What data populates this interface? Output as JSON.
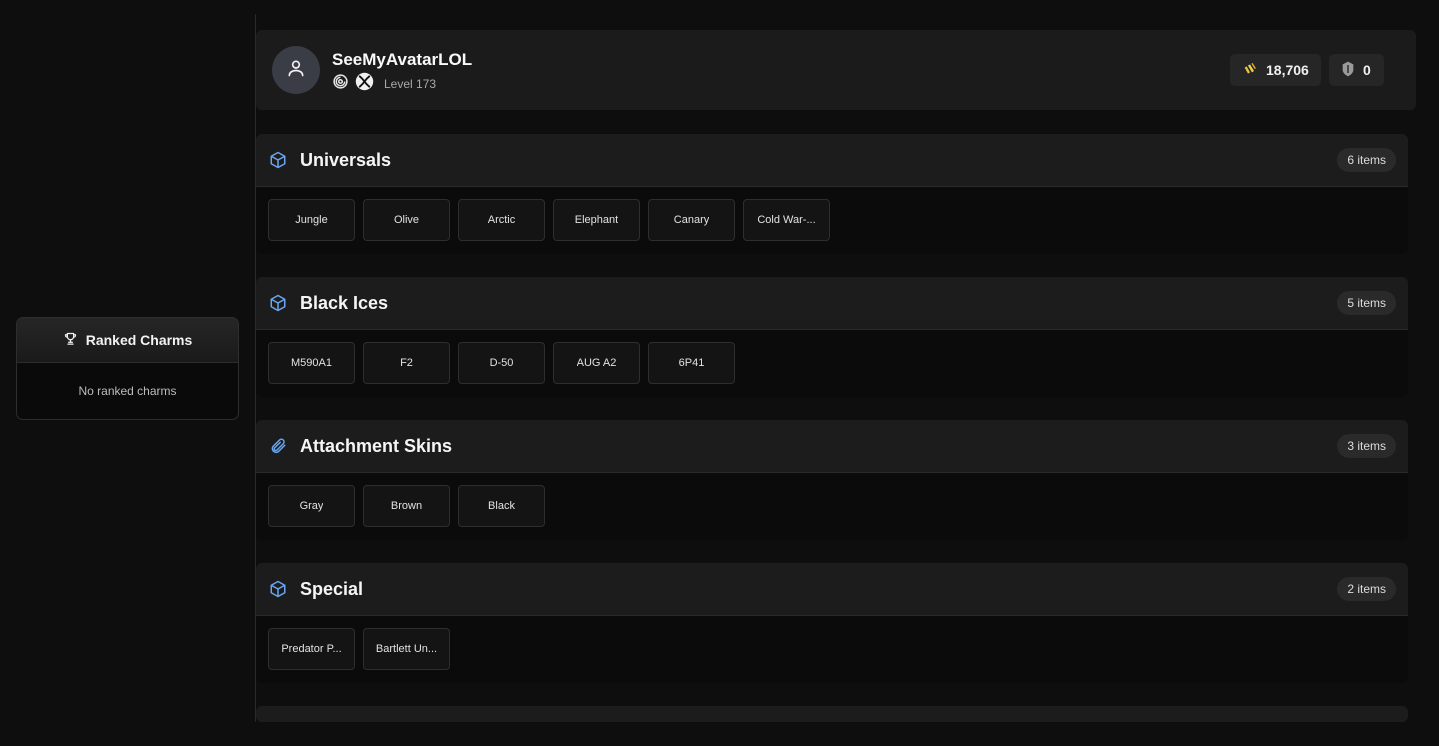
{
  "ranked_charms": {
    "title": "Ranked Charms",
    "empty_text": "No ranked charms",
    "icon": "trophy-icon"
  },
  "profile": {
    "username": "SeeMyAvatarLOL",
    "level": "Level 173",
    "platform_icons": [
      "ubisoft-icon",
      "xbox-icon"
    ],
    "avatar_icon": "user-icon",
    "renown": "18,706",
    "credits": "0"
  },
  "sections": [
    {
      "title": "Universals",
      "count": "6 items",
      "icon": "cube-icon",
      "items": [
        "Jungle",
        "Olive",
        "Arctic",
        "Elephant",
        "Canary",
        "Cold War-..."
      ]
    },
    {
      "title": "Black Ices",
      "count": "5 items",
      "icon": "cube-icon",
      "items": [
        "M590A1",
        "F2",
        "D-50",
        "AUG A2",
        "6P41"
      ]
    },
    {
      "title": "Attachment Skins",
      "count": "3 items",
      "icon": "paperclip-icon",
      "items": [
        "Gray",
        "Brown",
        "Black"
      ]
    },
    {
      "title": "Special",
      "count": "2 items",
      "icon": "cube-icon",
      "items": [
        "Predator P...",
        "Bartlett Un..."
      ]
    }
  ],
  "colors": {
    "background": "#0e0e0e",
    "panel": "#1b1b1b",
    "accent_icon": "#6aa6f2",
    "renown": "#e8c43a"
  }
}
